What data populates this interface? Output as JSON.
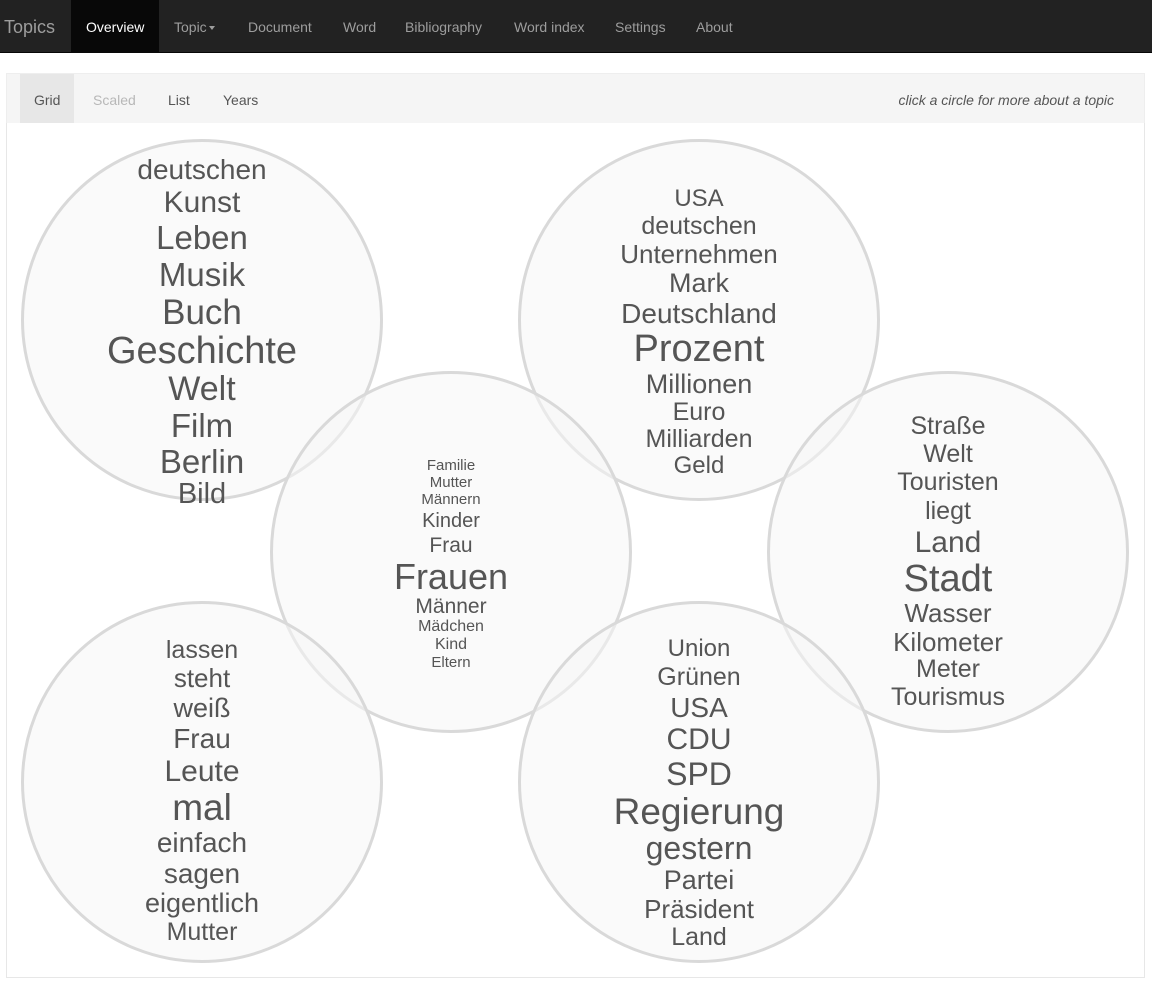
{
  "navbar": {
    "brand": "Topics",
    "items": [
      {
        "label": "Overview"
      },
      {
        "label": "Topic"
      },
      {
        "label": "Document"
      },
      {
        "label": "Word"
      },
      {
        "label": "Bibliography"
      },
      {
        "label": "Word index"
      },
      {
        "label": "Settings"
      },
      {
        "label": "About"
      }
    ]
  },
  "subnav": {
    "items": [
      {
        "label": "Grid"
      },
      {
        "label": "Scaled"
      },
      {
        "label": "List"
      },
      {
        "label": "Years"
      }
    ],
    "hint": "click a circle for more about a topic"
  },
  "topics": [
    {
      "words": [
        "deutschen",
        "Kunst",
        "Leben",
        "Musik",
        "Buch",
        "Geschichte",
        "Welt",
        "Film",
        "Berlin",
        "Bild"
      ]
    },
    {
      "words": [
        "USA",
        "deutschen",
        "Unternehmen",
        "Mark",
        "Deutschland",
        "Prozent",
        "Millionen",
        "Euro",
        "Milliarden",
        "Geld"
      ]
    },
    {
      "words": [
        "Familie",
        "Mutter",
        "Männern",
        "Kinder",
        "Frau",
        "Frauen",
        "Männer",
        "Mädchen",
        "Kind",
        "Eltern"
      ]
    },
    {
      "words": [
        "Straße",
        "Welt",
        "Touristen",
        "liegt",
        "Land",
        "Stadt",
        "Wasser",
        "Kilometer",
        "Meter",
        "Tourismus"
      ]
    },
    {
      "words": [
        "lassen",
        "steht",
        "weiß",
        "Frau",
        "Leute",
        "mal",
        "einfach",
        "sagen",
        "eigentlich",
        "Mutter"
      ]
    },
    {
      "words": [
        "Union",
        "Grünen",
        "USA",
        "CDU",
        "SPD",
        "Regierung",
        "gestern",
        "Partei",
        "Präsident",
        "Land"
      ]
    }
  ]
}
